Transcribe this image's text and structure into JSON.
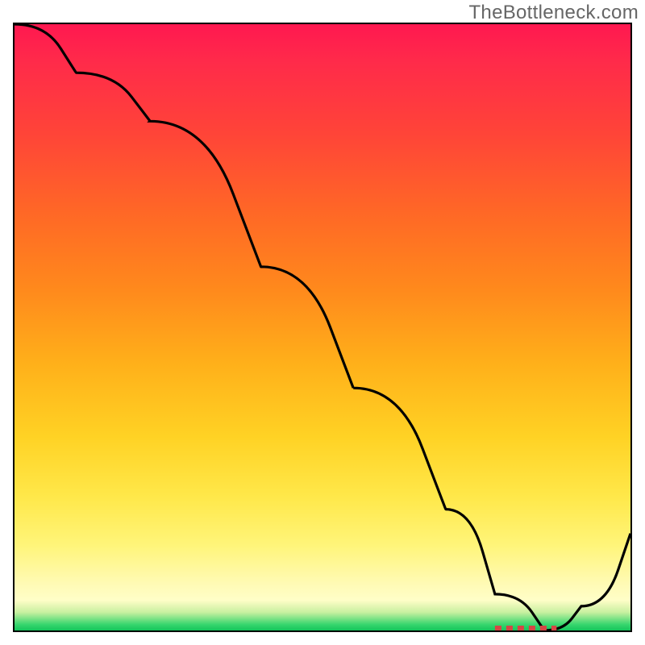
{
  "watermark": "TheBottleneck.com",
  "colors": {
    "gradient_top": "#ff1850",
    "gradient_mid1": "#ff8a1c",
    "gradient_mid2": "#ffe84a",
    "gradient_bottom_pale": "#fffec8",
    "gradient_green": "#14c45a",
    "curve": "#000000",
    "flat_marker": "#d64545"
  },
  "chart_data": {
    "type": "line",
    "title": "",
    "xlabel": "",
    "ylabel": "",
    "xlim": [
      0,
      100
    ],
    "ylim": [
      0,
      100
    ],
    "series": [
      {
        "name": "bottleneck-curve",
        "x": [
          0,
          10,
          22,
          40,
          55,
          70,
          78,
          86,
          92,
          100
        ],
        "values": [
          100,
          92,
          84,
          60,
          40,
          20,
          6,
          0,
          4,
          16
        ]
      }
    ],
    "annotations": [
      {
        "name": "optimal-flat-region",
        "x_start": 78,
        "x_end": 88,
        "y": 0
      }
    ],
    "grid": false,
    "legend": false
  }
}
